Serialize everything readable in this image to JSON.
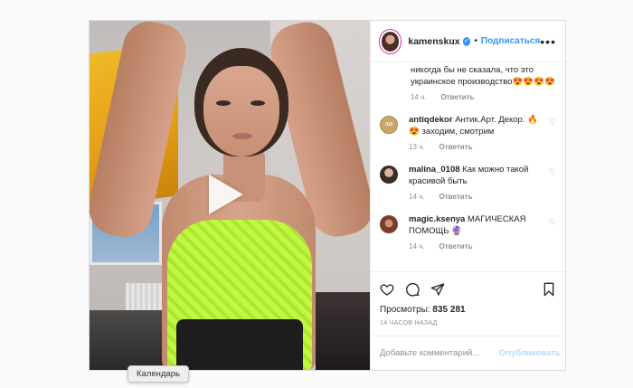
{
  "post": {
    "username": "kamenskux",
    "follow_label": "Подписаться",
    "separator": "•",
    "more_label": "•••",
    "play_icon": "play-icon"
  },
  "comments": {
    "partial": {
      "text": "никогда бы не сказала, что это украинское производство😍😍😍😍",
      "time": "14 ч.",
      "reply": "Ответить"
    },
    "items": [
      {
        "user": "antiqdekor",
        "text": "Антик.Арт. Декор. 🔥😍 заходим, смотрим",
        "time": "13 ч.",
        "reply": "Ответить",
        "avatar_text": "AD"
      },
      {
        "user": "malina_0108",
        "text": "Как можно такой красивой быть",
        "time": "14 ч.",
        "reply": "Ответить"
      },
      {
        "user": "magic.ksenya",
        "text": "МАГИЧЕСКАЯ ПОМОЩЬ 🔮",
        "time": "14 ч.",
        "reply": "Ответить"
      }
    ]
  },
  "stats": {
    "views_label": "Просмотры:",
    "views_count": "835 281",
    "time_ago": "14 ЧАСОВ НАЗАД"
  },
  "add_comment": {
    "placeholder": "Добавьте комментарий...",
    "publish_label": "Опубликовать"
  },
  "tooltip": {
    "text": "Календарь"
  },
  "colors": {
    "accent": "#3897f0",
    "publish_disabled": "#b3dbff",
    "border": "#dbdbdb"
  }
}
